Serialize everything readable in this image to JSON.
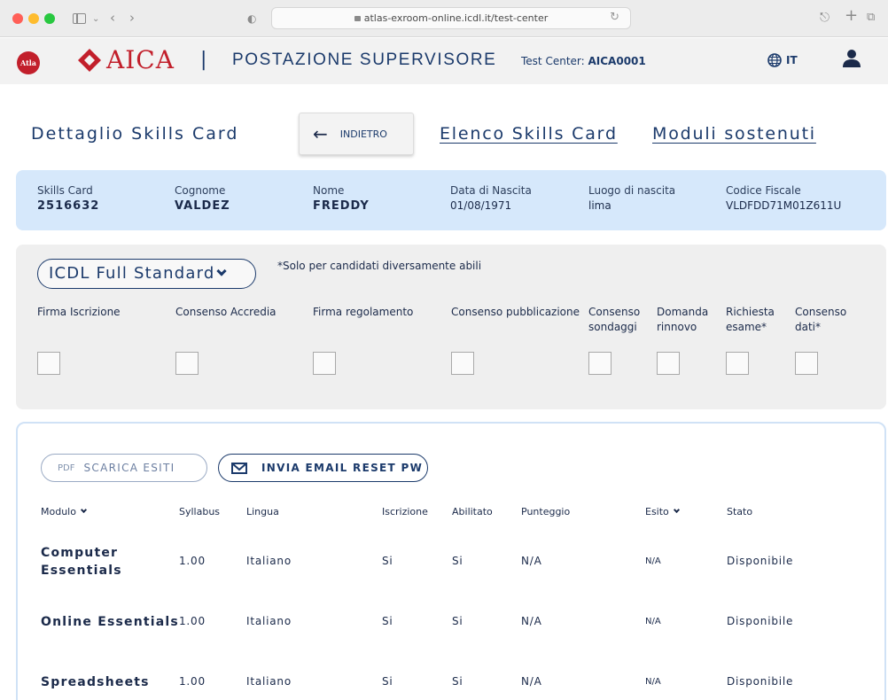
{
  "browser": {
    "url": "atlas-exroom-online.icdl.it/test-center"
  },
  "header": {
    "brand": "AICA",
    "atla_logo_text": "Atla",
    "separator": "|",
    "station": "POSTAZIONE SUPERVISORE",
    "test_center_label": "Test Center:",
    "test_center_code": "AICA0001",
    "language": "IT"
  },
  "title_row": {
    "page_title": "Dettaglio Skills Card",
    "back_label": "INDIETRO",
    "link_list": "Elenco Skills Card",
    "link_modules": "Moduli sostenuti"
  },
  "candidate": {
    "fields": [
      {
        "label": "Skills Card",
        "value": "2516632"
      },
      {
        "label": "Cognome",
        "value": "VALDEZ"
      },
      {
        "label": "Nome",
        "value": "FREDDY"
      },
      {
        "label": "Data di Nascita",
        "value": "01/08/1971"
      },
      {
        "label": "Luogo di nascita",
        "value": "lima"
      },
      {
        "label": "Codice Fiscale",
        "value": "VLDFDD71M01Z611U"
      }
    ]
  },
  "consent": {
    "certification": "ICDL Full Standard",
    "note": "*Solo per candidati diversamente abili",
    "items": [
      {
        "label": "Firma Iscrizione",
        "checked": false
      },
      {
        "label": "Consenso Accredia",
        "checked": false
      },
      {
        "label": "Firma regolamento",
        "checked": false
      },
      {
        "label": "Consenso pubblicazione",
        "checked": false
      },
      {
        "label_line1": "Consenso",
        "label_line2": "sondaggi",
        "checked": false
      },
      {
        "label_line1": "Domanda",
        "label_line2": "rinnovo",
        "checked": false
      },
      {
        "label_line1": "Richiesta",
        "label_line2": "esame*",
        "checked": false
      },
      {
        "label_line1": "Consenso",
        "label_line2": "dati*",
        "checked": false
      }
    ]
  },
  "results": {
    "pdf_tag": "PDF",
    "download_label": "SCARICA ESITI",
    "email_label": "INVIA EMAIL RESET PW",
    "columns": [
      "Modulo",
      "Syllabus",
      "Lingua",
      "Iscrizione",
      "Abilitato",
      "Punteggio",
      "Esito",
      "Stato"
    ],
    "rows": [
      {
        "module_line1": "Computer",
        "module_line2": "Essentials",
        "syllabus": "1.00",
        "language": "Italiano",
        "enrolled": "Si",
        "enabled": "Si",
        "score": "N/A",
        "outcome": "N/A",
        "status": "Disponibile"
      },
      {
        "module_line1": "Online Essentials",
        "module_line2": "",
        "syllabus": "1.00",
        "language": "Italiano",
        "enrolled": "Si",
        "enabled": "Si",
        "score": "N/A",
        "outcome": "N/A",
        "status": "Disponibile"
      },
      {
        "module_line1": "Spreadsheets",
        "module_line2": "",
        "syllabus": "1.00",
        "language": "Italiano",
        "enrolled": "Si",
        "enabled": "Si",
        "score": "N/A",
        "outcome": "N/A",
        "status": "Disponibile"
      }
    ]
  },
  "colors": {
    "brand_red": "#c21f2b",
    "navy": "#1b3a6b",
    "info_bg": "#d6e8fb",
    "consent_bg": "#efefef"
  },
  "icons": [
    "sidebar-icon",
    "back-icon",
    "forward-icon",
    "shield-icon",
    "share-icon",
    "new-tab-icon",
    "tabs-icon",
    "globe-icon",
    "user-icon",
    "arrow-left-icon",
    "chevron-down-icon",
    "mail-icon"
  ]
}
